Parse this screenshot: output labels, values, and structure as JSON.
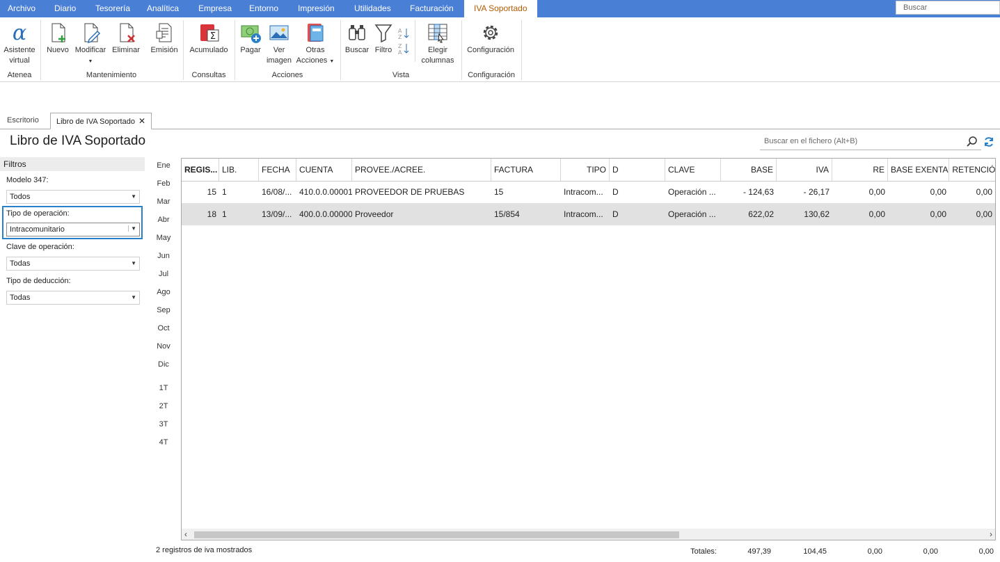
{
  "menu": {
    "tabs": [
      "Archivo",
      "Diario",
      "Tesorería",
      "Analítica",
      "Empresa",
      "Entorno",
      "Impresión",
      "Utilidades",
      "Facturación",
      "IVA Soportado"
    ],
    "search_placeholder": "Buscar"
  },
  "ribbon": {
    "asistente": "Asistente",
    "virtual": "virtual",
    "nuevo": "Nuevo",
    "modificar": "Modificar",
    "eliminar": "Eliminar",
    "emision": "Emisión",
    "acumulado": "Acumulado",
    "pagar": "Pagar",
    "ver": "Ver",
    "imagen": "imagen",
    "otras": "Otras",
    "acciones_btn": "Acciones",
    "buscar": "Buscar",
    "filtro": "Filtro",
    "elegir": "Elegir",
    "columnas": "columnas",
    "configuracion": "Configuración",
    "groups": {
      "atenea": "Atenea",
      "mantenimiento": "Mantenimiento",
      "consultas": "Consultas",
      "acciones": "Acciones",
      "vista": "Vista",
      "configuracion": "Configuración"
    }
  },
  "doc_tabs": {
    "escritorio": "Escritorio",
    "libro": "Libro de IVA Soportado"
  },
  "page": {
    "title": "Libro de IVA Soportado",
    "file_search_placeholder": "Buscar en el fichero (Alt+B)"
  },
  "filters": {
    "header": "Filtros",
    "modelo_label": "Modelo 347:",
    "modelo_value": "Todos",
    "tipo_op_label": "Tipo de operación:",
    "tipo_op_value": "Intracomunitario",
    "clave_label": "Clave de operación:",
    "clave_value": "Todas",
    "deduccion_label": "Tipo de deducción:",
    "deduccion_value": "Todas"
  },
  "months": [
    "Ene",
    "Feb",
    "Mar",
    "Abr",
    "May",
    "Jun",
    "Jul",
    "Ago",
    "Sep",
    "Oct",
    "Nov",
    "Dic"
  ],
  "quarters": [
    "1T",
    "2T",
    "3T",
    "4T"
  ],
  "grid": {
    "headers": [
      "REGIS...",
      "LIB.",
      "FECHA",
      "CUENTA",
      "PROVEE./ACREE.",
      "FACTURA",
      "TIPO",
      "D",
      "CLAVE",
      "BASE",
      "IVA",
      "RE",
      "BASE EXENTA",
      "RETENCIÓN"
    ],
    "rows": [
      [
        "15",
        "1",
        "16/08/...",
        "410.0.0.00001",
        "PROVEEDOR DE PRUEBAS",
        "15",
        "Intracom...",
        "D",
        "Operación ...",
        "- 124,63",
        "- 26,17",
        "0,00",
        "0,00",
        "0,00"
      ],
      [
        "18",
        "1",
        "13/09/...",
        "400.0.0.00000",
        "Proveedor",
        "15/854",
        "Intracom...",
        "D",
        "Operación ...",
        "622,02",
        "130,62",
        "0,00",
        "0,00",
        "0,00"
      ]
    ]
  },
  "footer": {
    "status": "2 registros de iva mostrados",
    "totales_label": "Totales:",
    "totals": [
      "497,39",
      "104,45",
      "0,00",
      "0,00",
      "0,00"
    ]
  },
  "colors": {
    "menubar": "#4a7fd6",
    "active_tab_text": "#b25900",
    "focus_border": "#2a80c8",
    "selected_row": "#e1e1e1"
  }
}
